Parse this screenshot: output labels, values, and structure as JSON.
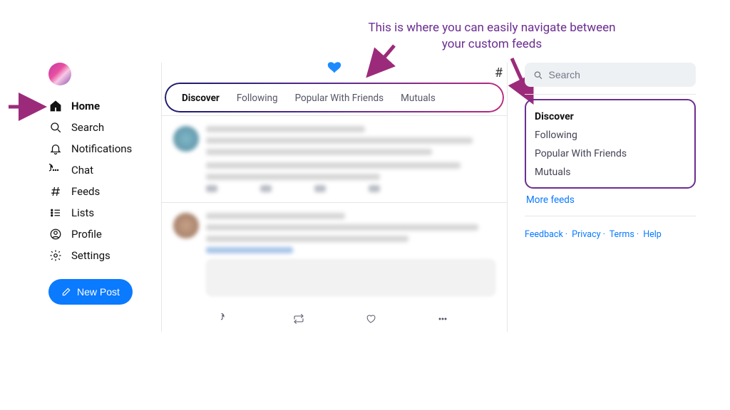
{
  "annotation": "This is where you can easily navigate between your custom feeds",
  "sidebar": {
    "items": [
      {
        "label": "Home",
        "icon": "home"
      },
      {
        "label": "Search",
        "icon": "search"
      },
      {
        "label": "Notifications",
        "icon": "bell"
      },
      {
        "label": "Chat",
        "icon": "chat"
      },
      {
        "label": "Feeds",
        "icon": "hash"
      },
      {
        "label": "Lists",
        "icon": "lists"
      },
      {
        "label": "Profile",
        "icon": "profile"
      },
      {
        "label": "Settings",
        "icon": "gear"
      }
    ],
    "newPostLabel": "New Post"
  },
  "tabs": [
    "Discover",
    "Following",
    "Popular With Friends",
    "Mutuals"
  ],
  "activeTab": "Discover",
  "search": {
    "placeholder": "Search"
  },
  "rightFeeds": [
    "Discover",
    "Following",
    "Popular With Friends",
    "Mutuals"
  ],
  "moreFeeds": "More feeds",
  "footer": [
    "Feedback",
    "Privacy",
    "Terms",
    "Help"
  ]
}
